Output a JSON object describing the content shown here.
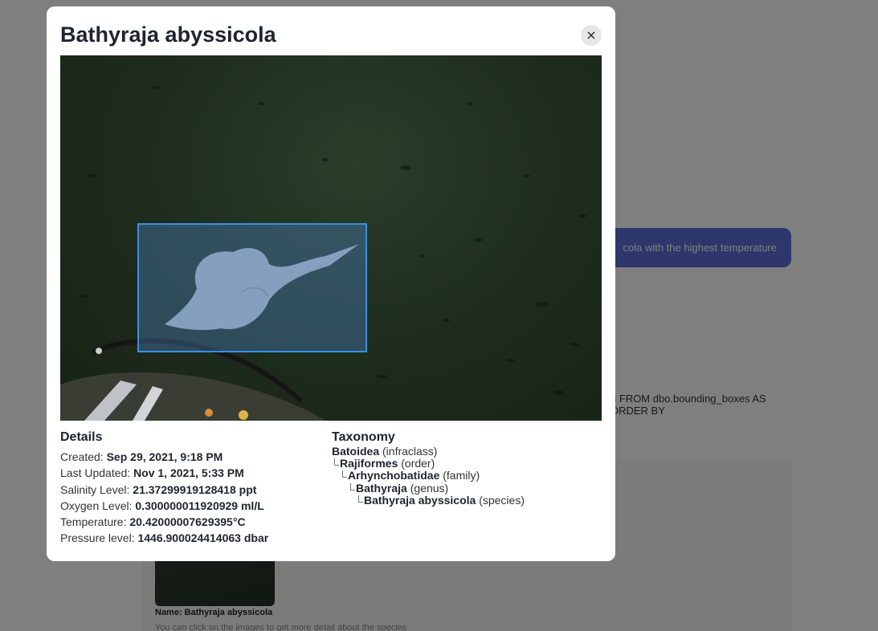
{
  "background": {
    "bubble_text": "cola with the highest temperature",
    "sql_text": "d FROM dbo.bounding_boxes AS\nORDER BY",
    "thumb_name": "Name: Bathyraja abyssicola",
    "hint": "You can click on the images to get more detail about the species"
  },
  "modal": {
    "title": "Bathyraja abyssicola",
    "close_label": "×",
    "details": {
      "heading": "Details",
      "rows": [
        {
          "label": "Created:",
          "value": "Sep 29, 2021, 9:18 PM"
        },
        {
          "label": "Last Updated:",
          "value": "Nov 1, 2021, 5:33 PM"
        },
        {
          "label": "Salinity Level:",
          "value": "21.37299919128418 ppt"
        },
        {
          "label": "Oxygen Level:",
          "value": "0.300000011920929 ml/L"
        },
        {
          "label": "Temperature:",
          "value": "20.42000007629395°C"
        },
        {
          "label": "Pressure level:",
          "value": "1446.900024414063 dbar"
        }
      ]
    },
    "taxonomy": {
      "heading": "Taxonomy",
      "rows": [
        {
          "name": "Batoidea",
          "rank": "(infraclass)"
        },
        {
          "name": "Rajiformes",
          "rank": "(order)"
        },
        {
          "name": "Arhynchobatidae",
          "rank": "(family)"
        },
        {
          "name": "Bathyraja",
          "rank": "(genus)"
        },
        {
          "name": "Bathyraja abyssicola",
          "rank": "(species)"
        }
      ]
    }
  },
  "colors": {
    "bbox": "#3b8fe6",
    "bubble": "#5b6fd6"
  }
}
